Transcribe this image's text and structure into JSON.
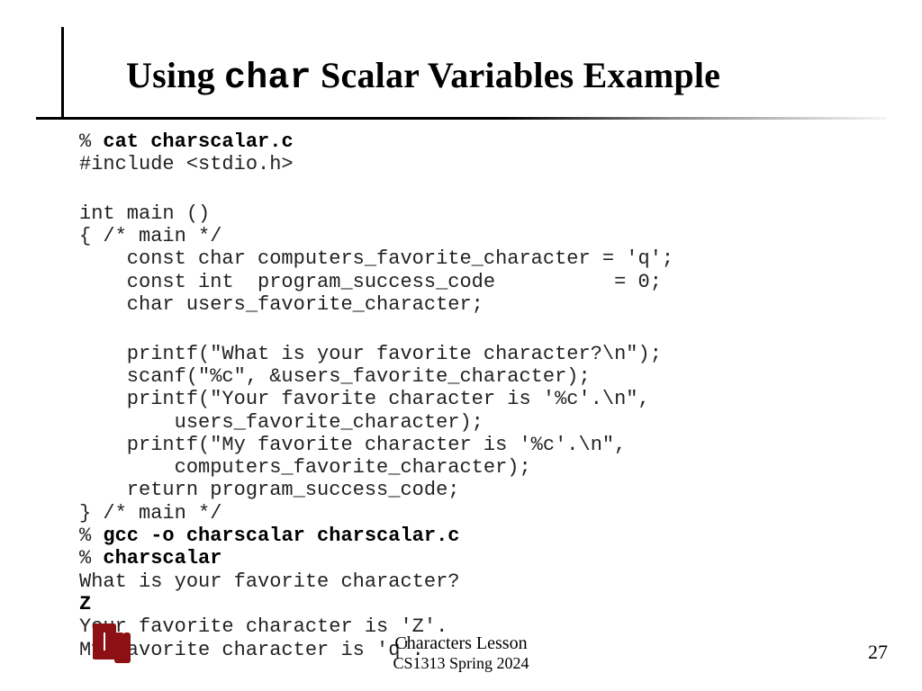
{
  "title": {
    "pre": "Using  ",
    "mono": "char",
    "post": "  Scalar Variables Example"
  },
  "code": {
    "l01a": "% ",
    "l01b": "cat charscalar.c",
    "l02": "#include <stdio.h>",
    "l03": "int main ()",
    "l04": "{ /* main */",
    "l05": "    const char computers_favorite_character = 'q';",
    "l06": "    const int  program_success_code          = 0;",
    "l07": "    char users_favorite_character;",
    "l08": "    printf(\"What is your favorite character?\\n\");",
    "l09": "    scanf(\"%c\", &users_favorite_character);",
    "l10": "    printf(\"Your favorite character is '%c'.\\n\",",
    "l11": "        users_favorite_character);",
    "l12": "    printf(\"My favorite character is '%c'.\\n\",",
    "l13": "        computers_favorite_character);",
    "l14": "    return program_success_code;",
    "l15": "} /* main */",
    "l16a": "% ",
    "l16b": "gcc -o charscalar charscalar.c",
    "l17a": "% ",
    "l17b": "charscalar",
    "l18": "What is your favorite character?",
    "l19": "Z",
    "l20": "Your favorite character is 'Z'.",
    "l21": "My favorite character is 'q'."
  },
  "footer": {
    "line1": "Characters Lesson",
    "line2": "CS1313 Spring 2024",
    "page": "27"
  }
}
